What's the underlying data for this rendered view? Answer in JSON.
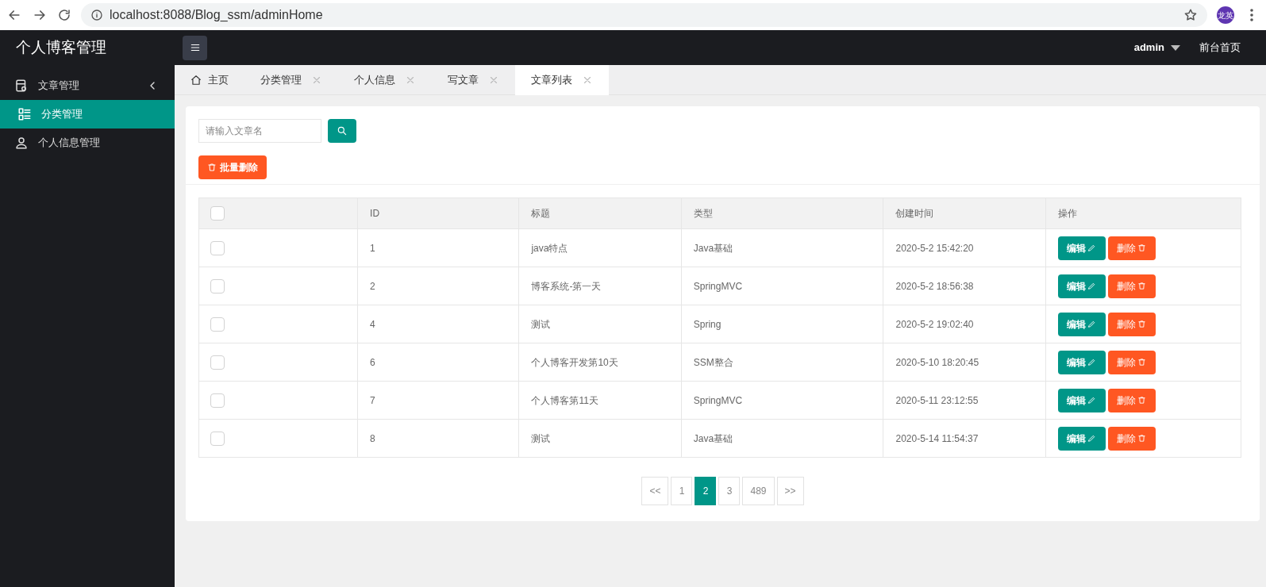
{
  "browser": {
    "url": "localhost:8088/Blog_ssm/adminHome",
    "profile": "龙英"
  },
  "header": {
    "title": "个人博客管理",
    "user": "admin",
    "front_link": "前台首页"
  },
  "sidebar": {
    "items": [
      {
        "label": "文章管理",
        "selected": false,
        "expanded": false
      },
      {
        "label": "分类管理",
        "selected": true
      },
      {
        "label": "个人信息管理",
        "selected": false
      }
    ]
  },
  "tabs": [
    {
      "label": "主页",
      "kind": "home",
      "selected": false
    },
    {
      "label": "分类管理",
      "kind": "page",
      "selected": false
    },
    {
      "label": "个人信息",
      "kind": "page",
      "selected": false
    },
    {
      "label": "写文章",
      "kind": "page",
      "selected": false
    },
    {
      "label": "文章列表",
      "kind": "page",
      "selected": true
    }
  ],
  "search": {
    "placeholder": "请输入文章名"
  },
  "batch_delete": "批量删除",
  "table": {
    "header_checked": false,
    "columns": [
      "ID",
      "标题",
      "类型",
      "创建时间",
      "操作"
    ],
    "rows": [
      {
        "checked": false,
        "id": "1",
        "title": "java特点",
        "type": "Java基础",
        "created": "2020-5-2 15:42:20",
        "edit": "编辑",
        "delete": "删除"
      },
      {
        "checked": false,
        "id": "2",
        "title": "博客系统-第一天",
        "type": "SpringMVC",
        "created": "2020-5-2 18:56:38",
        "edit": "编辑",
        "delete": "删除"
      },
      {
        "checked": false,
        "id": "4",
        "title": "测试",
        "type": "Spring",
        "created": "2020-5-2 19:02:40",
        "edit": "编辑",
        "delete": "删除"
      },
      {
        "checked": false,
        "id": "6",
        "title": "个人博客开发第10天",
        "type": "SSM整合",
        "created": "2020-5-10 18:20:45",
        "edit": "编辑",
        "delete": "删除"
      },
      {
        "checked": false,
        "id": "7",
        "title": "个人博客第11天",
        "type": "SpringMVC",
        "created": "2020-5-11 23:12:55",
        "edit": "编辑",
        "delete": "删除"
      },
      {
        "checked": false,
        "id": "8",
        "title": "测试",
        "type": "Java基础",
        "created": "2020-5-14 11:54:37",
        "edit": "编辑",
        "delete": "删除"
      }
    ]
  },
  "pagination": [
    {
      "label": "<<",
      "selected": false
    },
    {
      "label": "1",
      "selected": false
    },
    {
      "label": "2",
      "selected": true
    },
    {
      "label": "3",
      "selected": false
    },
    {
      "label": "489",
      "selected": false
    },
    {
      "label": ">>",
      "selected": false
    }
  ]
}
